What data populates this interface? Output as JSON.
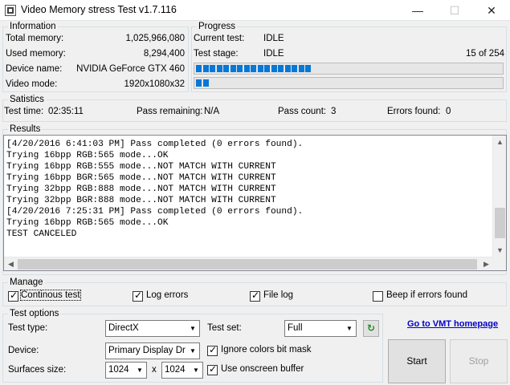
{
  "window": {
    "title": "Video Memory stress Test v1.7.116",
    "minimize": "—",
    "maximize": "☐",
    "close": "✕"
  },
  "information": {
    "legend": "Information",
    "rows": [
      {
        "label": "Total memory:",
        "value": "1,025,966,080"
      },
      {
        "label": "Used memory:",
        "value": "8,294,400"
      },
      {
        "label": "Device name:",
        "value": "NVIDIA GeForce GTX 460"
      },
      {
        "label": "Video mode:",
        "value": "1920x1080x32"
      }
    ]
  },
  "progress": {
    "legend": "Progress",
    "current_test_label": "Current test:",
    "current_test_value": "IDLE",
    "test_stage_label": "Test stage:",
    "test_stage_value": "IDLE",
    "stage_count": "15 of 254",
    "bar1_segments": 17,
    "bar2_segments": 2
  },
  "statistics": {
    "legend": "Satistics",
    "test_time_label": "Test time:",
    "test_time_value": "02:35:11",
    "pass_remaining_label": "Pass remaining:",
    "pass_remaining_value": "N/A",
    "pass_count_label": "Pass count:",
    "pass_count_value": "3",
    "errors_found_label": "Errors found:",
    "errors_found_value": "0"
  },
  "results": {
    "legend": "Results",
    "lines": [
      "[4/20/2016 6:41:03 PM] Pass completed (0 errors found).",
      "Trying 16bpp RGB:565 mode...OK",
      "Trying 16bpp RGB:555 mode...NOT MATCH WITH CURRENT",
      "Trying 16bpp BGR:565 mode...NOT MATCH WITH CURRENT",
      "Trying 32bpp RGB:888 mode...NOT MATCH WITH CURRENT",
      "Trying 32bpp BGR:888 mode...NOT MATCH WITH CURRENT",
      "[4/20/2016 7:25:31 PM] Pass completed (0 errors found).",
      "Trying 16bpp RGB:565 mode...OK",
      "TEST CANCELED"
    ]
  },
  "manage": {
    "legend": "Manage",
    "continuous_test": "Continous test",
    "log_errors": "Log errors",
    "file_log": "File log",
    "beep_if_errors": "Beep if errors found"
  },
  "test_options": {
    "legend": "Test options",
    "test_type_label": "Test type:",
    "test_type_value": "DirectX",
    "test_set_label": "Test set:",
    "test_set_value": "Full",
    "device_label": "Device:",
    "device_value": "Primary Display Driver",
    "ignore_colors": "Ignore colors bit mask",
    "surfaces_label": "Surfaces size:",
    "surface_w": "1024",
    "surface_x": "x",
    "surface_h": "1024",
    "use_onscreen": "Use onscreen buffer"
  },
  "link_text": "Go to VMT homepage",
  "buttons": {
    "start": "Start",
    "stop": "Stop"
  },
  "icons": {
    "dropdown": "▼",
    "refresh": "↻",
    "up": "▲",
    "down": "▼",
    "left": "◀",
    "right": "▶"
  },
  "colors": {
    "progress": "#0678d7",
    "link": "#0000cc"
  }
}
